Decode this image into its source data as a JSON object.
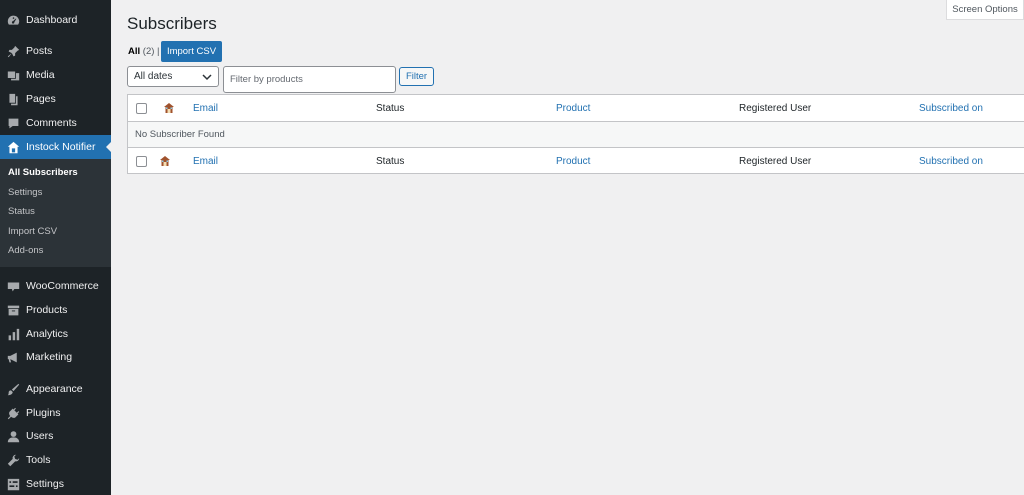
{
  "sidebar": {
    "items": [
      {
        "label": "Dashboard",
        "icon": "dashboard-icon"
      },
      {
        "label": "Posts",
        "icon": "pin-icon"
      },
      {
        "label": "Media",
        "icon": "media-icon"
      },
      {
        "label": "Pages",
        "icon": "pages-icon"
      },
      {
        "label": "Comments",
        "icon": "comment-icon"
      },
      {
        "label": "Instock Notifier",
        "icon": "bell-icon"
      },
      {
        "label": "WooCommerce",
        "icon": "woo-icon"
      },
      {
        "label": "Products",
        "icon": "archive-icon"
      },
      {
        "label": "Analytics",
        "icon": "bar-chart-icon"
      },
      {
        "label": "Marketing",
        "icon": "megaphone-icon"
      },
      {
        "label": "Appearance",
        "icon": "brush-icon"
      },
      {
        "label": "Plugins",
        "icon": "plug-icon"
      },
      {
        "label": "Users",
        "icon": "user-icon"
      },
      {
        "label": "Tools",
        "icon": "wrench-icon"
      },
      {
        "label": "Settings",
        "icon": "settings-icon"
      }
    ],
    "submenu": [
      "All Subscribers",
      "Settings",
      "Status",
      "Import CSV",
      "Add-ons"
    ]
  },
  "header": {
    "screen_options": "Screen Options",
    "title": "Subscribers"
  },
  "views": {
    "all_label": "All",
    "all_count": "(2)",
    "separator": "|",
    "import_button": "Import CSV"
  },
  "filters": {
    "date_value": "All dates",
    "products_placeholder": "Filter by products",
    "filter_button": "Filter"
  },
  "table": {
    "columns": [
      "Email",
      "Status",
      "Product",
      "Registered User",
      "Subscribed on"
    ],
    "empty_message": "No Subscriber Found"
  },
  "colors": {
    "accent": "#2271b1",
    "sidebar_bg": "#1d2327",
    "page_bg": "#f0f0f1"
  }
}
